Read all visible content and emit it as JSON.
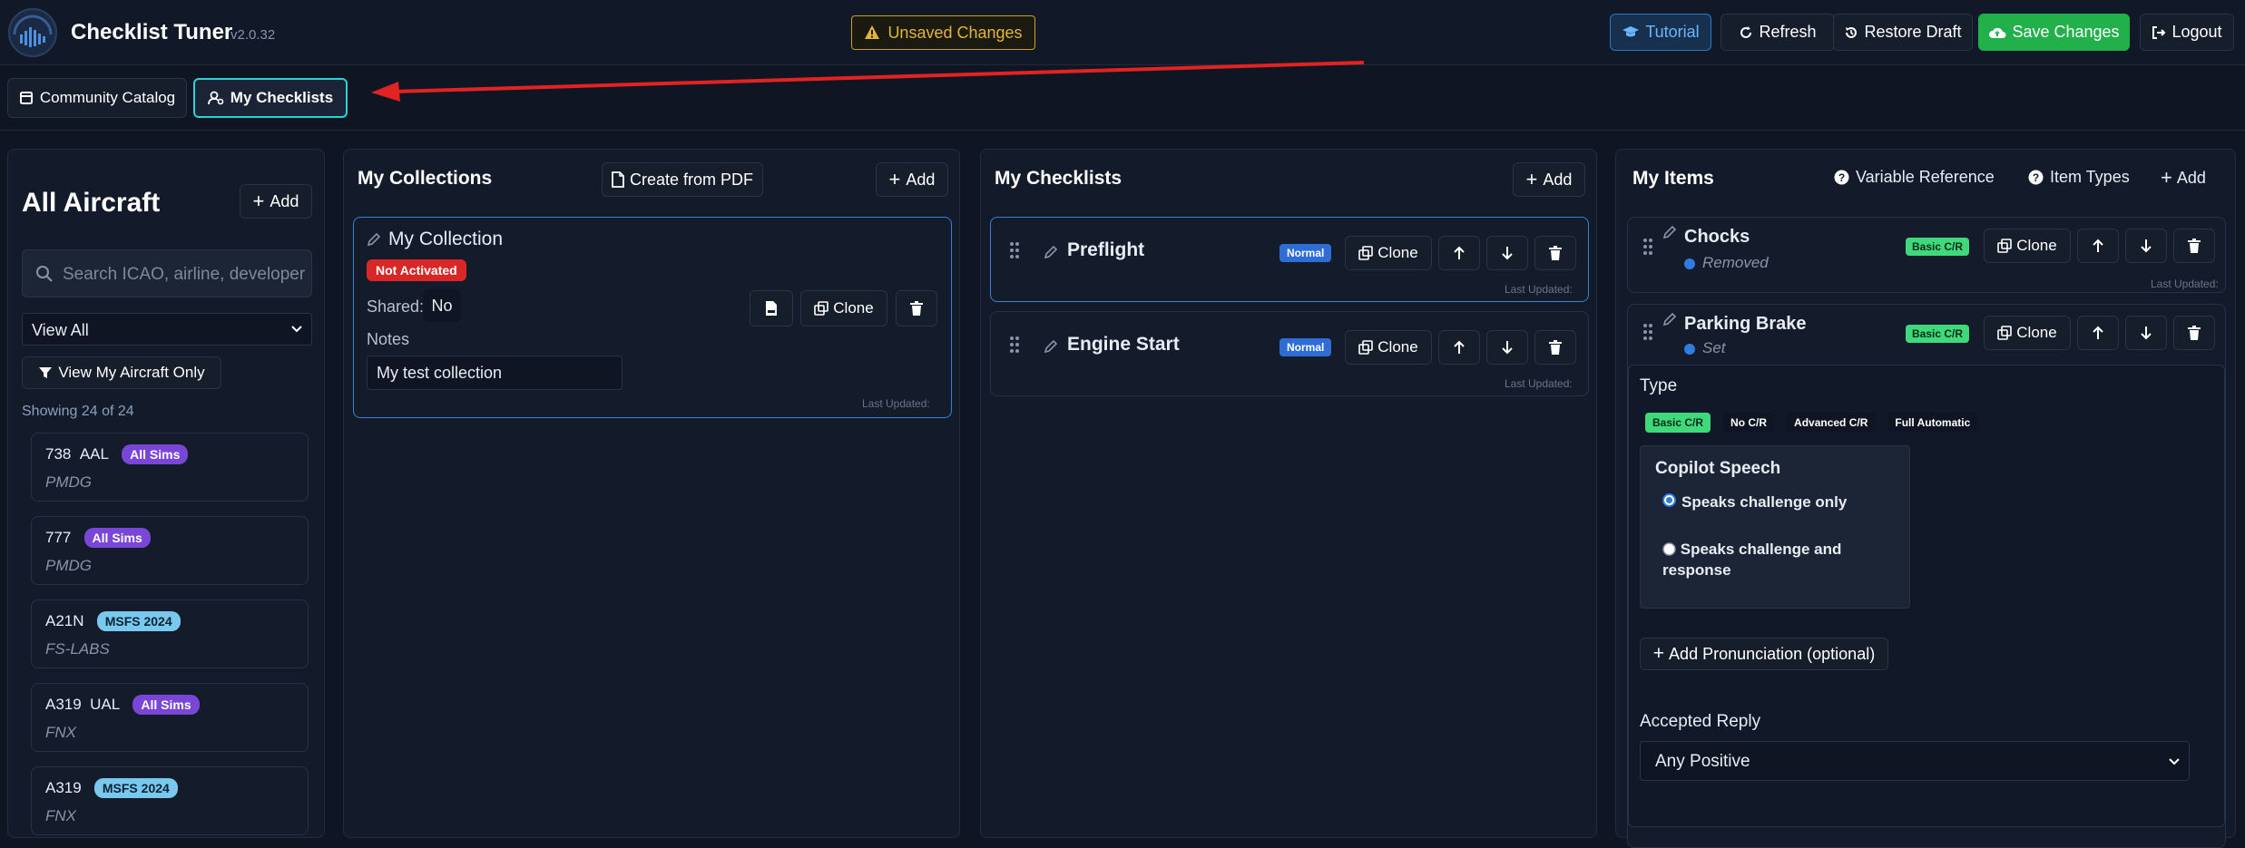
{
  "header": {
    "title": "Checklist Tuner",
    "version": "v2.0.32",
    "unsaved": "Unsaved Changes",
    "buttons": {
      "tutorial": "Tutorial",
      "refresh": "Refresh",
      "restore": "Restore Draft",
      "save": "Save Changes",
      "logout": "Logout"
    }
  },
  "tabs": {
    "community": "Community Catalog",
    "mine": "My Checklists"
  },
  "aircraft_panel": {
    "title": "All Aircraft",
    "add": "Add",
    "search_placeholder": "Search ICAO, airline, developer",
    "filter_value": "View All",
    "mine_only": "View My Aircraft Only",
    "showing": "Showing 24 of 24",
    "items": [
      {
        "icao": "738",
        "airline": "AAL",
        "sim": "All Sims",
        "dev": "PMDG"
      },
      {
        "icao": "777",
        "airline": "",
        "sim": "All Sims",
        "dev": "PMDG"
      },
      {
        "icao": "A21N",
        "airline": "",
        "sim": "MSFS 2024",
        "dev": "FS-LABS"
      },
      {
        "icao": "A319",
        "airline": "UAL",
        "sim": "All Sims",
        "dev": "FNX"
      },
      {
        "icao": "A319",
        "airline": "",
        "sim": "MSFS 2024",
        "dev": "FNX"
      }
    ]
  },
  "collections_panel": {
    "title": "My Collections",
    "create_pdf": "Create from PDF",
    "add": "Add",
    "collection": {
      "name": "My Collection",
      "status": "Not Activated",
      "shared_label": "Shared:",
      "shared_value": "No",
      "clone": "Clone",
      "notes_label": "Notes",
      "notes_value": "My test collection",
      "last_updated": "Last Updated:"
    }
  },
  "checklists_panel": {
    "title": "My Checklists",
    "add": "Add",
    "items": [
      {
        "name": "Preflight",
        "type": "Normal",
        "clone": "Clone",
        "last_updated": "Last Updated:"
      },
      {
        "name": "Engine Start",
        "type": "Normal",
        "clone": "Clone",
        "last_updated": "Last Updated:"
      }
    ]
  },
  "items_panel": {
    "title": "My Items",
    "var_ref": "Variable Reference",
    "item_types": "Item Types",
    "add": "Add",
    "items": [
      {
        "name": "Chocks",
        "state": "Removed",
        "type": "Basic C/R",
        "clone": "Clone",
        "last_updated": "Last Updated:"
      },
      {
        "name": "Parking Brake",
        "state": "Set",
        "type": "Basic C/R",
        "clone": "Clone"
      }
    ],
    "editor": {
      "type_label": "Type",
      "types": [
        "Basic C/R",
        "No C/R",
        "Advanced C/R",
        "Full Automatic"
      ],
      "copilot_title": "Copilot Speech",
      "option1": "Speaks challenge only",
      "option2": "Speaks challenge and response",
      "add_pron": "Add Pronunciation (optional)",
      "reply_label": "Accepted Reply",
      "reply_value": "Any Positive"
    }
  },
  "colors": {
    "accent": "#2ad4d4",
    "save": "#21b04a",
    "warning": "#e3b43a",
    "arrow": "#e32222"
  }
}
